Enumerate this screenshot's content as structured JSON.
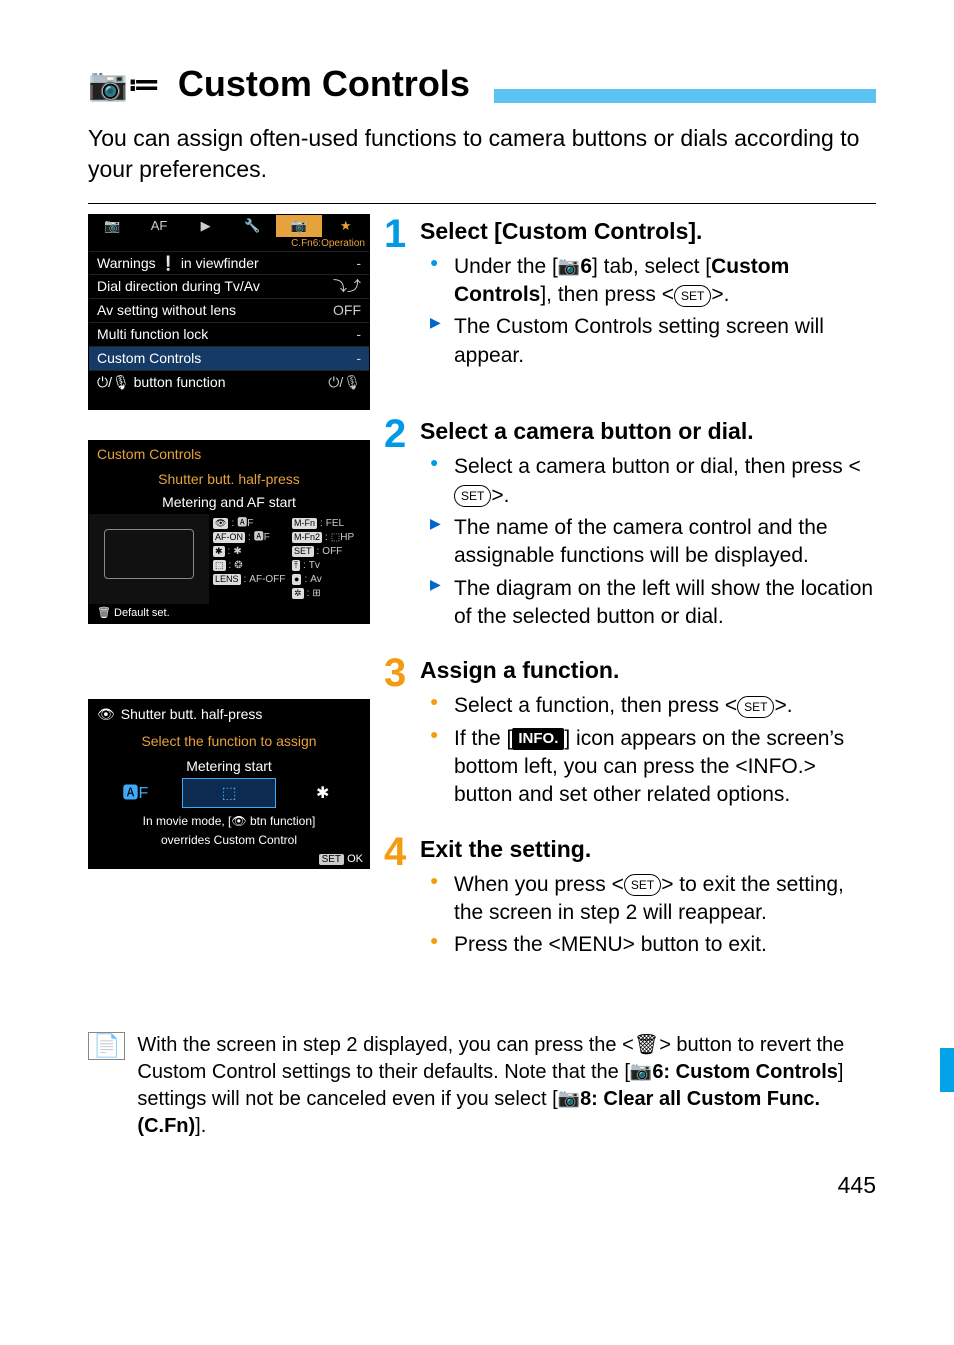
{
  "header": {
    "icon_glyphs": "📷≔",
    "title": "Custom Controls"
  },
  "intro": "You can assign often-used functions to camera buttons or dials according to your preferences.",
  "screens": {
    "menu": {
      "tabs": [
        "📷",
        "AF",
        "▶",
        "🔧",
        "📷",
        "★"
      ],
      "subtitle": "C.Fn6:Operation",
      "rows": [
        {
          "label": "Warnings ❕ in viewfinder",
          "value": "-"
        },
        {
          "label": "Dial direction during Tv/Av",
          "value": "⤵⤴"
        },
        {
          "label": "Av setting without lens",
          "value": "OFF"
        },
        {
          "label": "Multi function lock",
          "value": "-"
        },
        {
          "label": "Custom Controls",
          "value": "-",
          "selected": true
        },
        {
          "label": "⏻/🎙 button function",
          "value": "⏻/🎙"
        }
      ]
    },
    "custcontrols": {
      "title": "Custom Controls",
      "line1": "Shutter butt. half-press",
      "line2": "Metering and AF start",
      "chips": [
        {
          "k": "👁",
          "v": "🅰F"
        },
        {
          "k": "M-Fn",
          "v": "FEL"
        },
        {
          "k": "AF-ON",
          "v": "🅰F"
        },
        {
          "k": "M-Fn2",
          "v": "⬚HP"
        },
        {
          "k": "✱",
          "v": "✱"
        },
        {
          "k": "SET",
          "v": "OFF"
        },
        {
          "k": "⬚",
          "v": "❂"
        },
        {
          "k": "⤒",
          "v": "Tv"
        },
        {
          "k": "LENS",
          "v": "AF-OFF"
        },
        {
          "k": "●",
          "v": "Av"
        },
        {
          "k": "",
          "v": ""
        },
        {
          "k": "✲",
          "v": "⊞"
        }
      ],
      "footer_left": "🗑 Default set."
    },
    "assign": {
      "header_icon_label": "Shutter butt. half-press",
      "line1": "Select the function to assign",
      "line2": "Metering start",
      "tabs": [
        "🅰F",
        "⬚",
        "✱"
      ],
      "note1": "In movie mode, [👁 btn function]",
      "note2": "overrides Custom Control",
      "ok": "OK"
    }
  },
  "steps": {
    "s1": {
      "title": "Select [Custom Controls].",
      "b1a": "Under the [",
      "b1_tab": "6",
      "b1b": "] tab, select [",
      "b1_bold": "Custom Controls",
      "b1c": "], then press <",
      "b1d": ">.",
      "b2": "The Custom Controls setting screen will appear."
    },
    "s2": {
      "title": "Select a camera button or dial.",
      "b1a": "Select a camera button or dial, then press <",
      "b1b": ">.",
      "b2": "The name of the camera control and the assignable functions will be displayed.",
      "b3": "The diagram on the left will show the location of the selected button or dial."
    },
    "s3": {
      "title": "Assign a function.",
      "b1a": "Select a function, then press <",
      "b1b": ">.",
      "b2a": "If the [",
      "b2b": "] icon appears on the screen’s bottom left, you can press the <",
      "b2_btn": "INFO.",
      "b2c": "> button and set other related options."
    },
    "s4": {
      "title": "Exit the setting.",
      "b1a": "When you press <",
      "b1b": "> to exit the setting, the screen in step 2 will reappear.",
      "b2a": "Press the <",
      "b2_btn": "MENU",
      "b2b": "> button to exit."
    }
  },
  "note": {
    "a": "With the screen in step 2 displayed, you can press the <",
    "b": "> button to revert the Custom Control settings to their defaults. Note that the [",
    "tab1": "6: Custom Controls",
    "c": "] settings will not be canceled even if you select [",
    "tab2": "8: Clear all Custom Func. (C.Fn)",
    "d": "]."
  },
  "chips": {
    "set": "SET",
    "info": "INFO.",
    "trash": "🗑",
    "camera": "📷"
  },
  "pagenum": "445"
}
